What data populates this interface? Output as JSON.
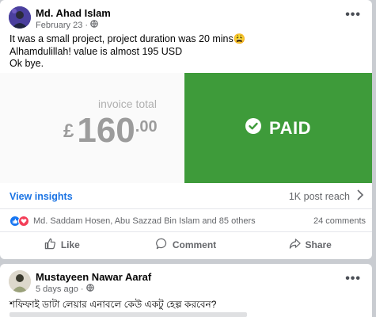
{
  "post1": {
    "author": "Md. Ahad Islam",
    "date": "February 23",
    "separator": "·",
    "audience_icon": "globe-icon",
    "lines": [
      "It was a small project, project duration was 20 mins😩",
      "Alhamdulillah! value is almost 195 USD",
      "Ok bye."
    ],
    "invoice": {
      "label": "invoice total",
      "currency": "£",
      "amount_int": "160",
      "amount_dec": ".00",
      "status": "PAID",
      "accent_color": "#3e9b3a"
    },
    "insights_link": "View insights",
    "post_reach": "1K post reach",
    "reactions_text": "Md. Saddam Hosen, Abu Sazzad Bin Islam and 85 others",
    "comments_count": "24 comments",
    "actions": {
      "like": "Like",
      "comment": "Comment",
      "share": "Share"
    }
  },
  "post2": {
    "author": "Mustayeen Nawar Aaraf",
    "date": "5 days ago",
    "separator": "·",
    "text": "শফিফাই ডাটা লেয়ার এনাবলে কেউ একটু হেল্প করবেন?"
  }
}
